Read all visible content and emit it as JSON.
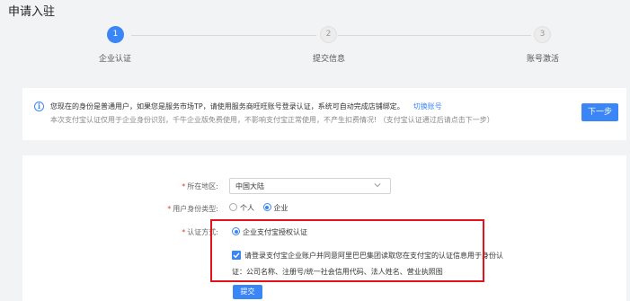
{
  "page": {
    "title": "申请入驻"
  },
  "steps": [
    {
      "number": "1",
      "label": "企业认证",
      "state": "active"
    },
    {
      "number": "2",
      "label": "提交信息",
      "state": "todo"
    },
    {
      "number": "3",
      "label": "账号激活",
      "state": "todo"
    }
  ],
  "notice": {
    "line1": "您现在的身份是普通用户，如果您是服务市场TP，请使用服务商旺旺账号登录认证，系统可自动完成店铺绑定。",
    "switch_link": "切换账号",
    "line2": "本次支付宝认证仅用于企业身份识别，千牛企业版免费使用，不影响支付宝正常使用，不产生扣费情况! （支付宝认证通过后请点击下一步）",
    "next_button": "下一步"
  },
  "form": {
    "required_mark": "*",
    "region": {
      "label": "所在地区:",
      "value": "中国大陆"
    },
    "identity": {
      "label": "用户身份类型:",
      "options": [
        "个人",
        "企业"
      ],
      "selected": "企业"
    },
    "method": {
      "label": "认证方式:",
      "option": "企业支付宝授权认证"
    },
    "consent": {
      "line1": "请登录支付宝企业账户并同意阿里巴巴集团读取您在支付宝的认证信息用于身份认",
      "line2": "证：公司名称、注册号/统一社会信用代码、法人姓名、营业执照图"
    },
    "submit_button": "提交"
  },
  "colors": {
    "primary": "#3b86f6",
    "highlight": "#e3121b",
    "required": "#e4393c"
  }
}
